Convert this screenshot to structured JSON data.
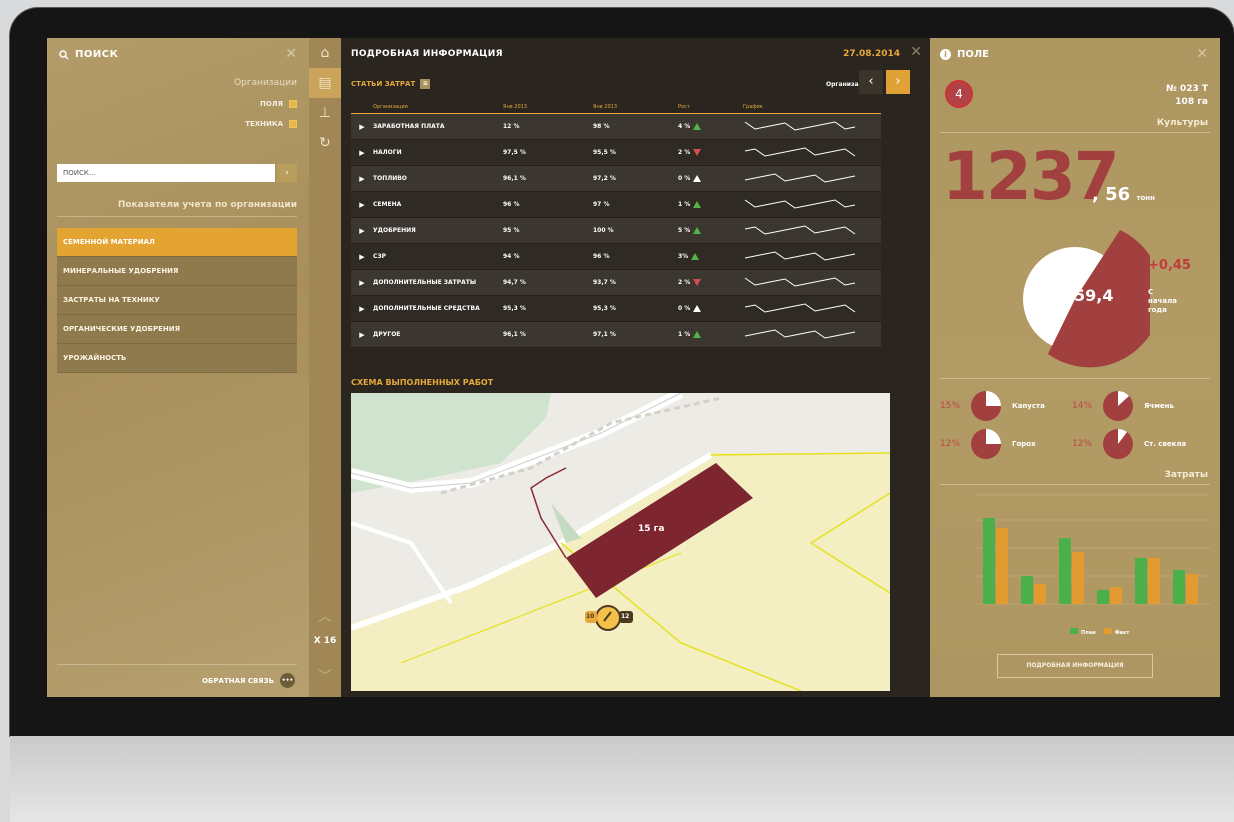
{
  "left_panel": {
    "search_title": "ПОИСК",
    "organizations_label": "Организации",
    "filters": [
      {
        "label": "ПОЛЯ",
        "checked": true
      },
      {
        "label": "ТЕХНИКА",
        "checked": true
      }
    ],
    "search_placeholder": "ПОИСК...",
    "indicators_title": "Показатели учета по организации",
    "menu": [
      {
        "label": "СЕМЕННОЙ МАТЕРИАЛ",
        "active": true
      },
      {
        "label": "МИНЕРАЛЬНЫЕ УДОБРЕНИЯ",
        "active": false
      },
      {
        "label": "ЗАСТРАТЫ НА ТЕХНИКУ",
        "active": false
      },
      {
        "label": "ОРГАНИЧЕСКИЕ УДОБРЕНИЯ",
        "active": false
      },
      {
        "label": "УРОЖАЙНОСТЬ",
        "active": false
      }
    ],
    "feedback_label": "ОБРАТНАЯ СВЯЗЬ"
  },
  "rail": {
    "icons": [
      "home-icon",
      "map-icon",
      "hierarchy-icon",
      "refresh-icon"
    ],
    "zoom": "X 16"
  },
  "center": {
    "title": "ПОДРОБНАЯ ИНФОРМАЦИЯ",
    "date": "27.08.2014",
    "section": "СТАТЬИ ЗАТРАТ",
    "org_label": "Организация",
    "columns": [
      "Организация",
      "Янв 2013",
      "Янв 2013",
      "Рост",
      "График"
    ],
    "rows": [
      {
        "name": "ЗАРАБОТНАЯ ПЛАТА",
        "v1": "12 %",
        "v2": "98 %",
        "growth": "4 %",
        "trend": "up"
      },
      {
        "name": "НАЛОГИ",
        "v1": "97,5 %",
        "v2": "95,5 %",
        "growth": "2 %",
        "trend": "down"
      },
      {
        "name": "ТОПЛИВО",
        "v1": "96,1 %",
        "v2": "97,2 %",
        "growth": "0 %",
        "trend": "neutral"
      },
      {
        "name": "СЕМЕНА",
        "v1": "96 %",
        "v2": "97 %",
        "growth": "1 %",
        "trend": "up"
      },
      {
        "name": "УДОБРЕНИЯ",
        "v1": "95 %",
        "v2": "100 %",
        "growth": "5 %",
        "trend": "up"
      },
      {
        "name": "СЗР",
        "v1": "94 %",
        "v2": "96 %",
        "growth": "3% ",
        "trend": "up"
      },
      {
        "name": "ДОПОЛНИТЕЛЬНЫЕ ЗАТРАТЫ",
        "v1": "94,7 %",
        "v2": "93,7 %",
        "growth": "2 %",
        "trend": "down"
      },
      {
        "name": "ДОПОЛНИТЕЛЬНЫЕ СРЕДСТВА",
        "v1": "95,3 %",
        "v2": "95,3 %",
        "growth": "0 %",
        "trend": "neutral"
      },
      {
        "name": "ДРУГОЕ",
        "v1": "96,1 %",
        "v2": "97,1 %",
        "growth": "1 %",
        "trend": "up"
      }
    ],
    "map_title": "СХЕМА ВЫПОЛНЕННЫХ РАБОТ",
    "map_area": "15 га",
    "map_left_count": "10",
    "map_right_count": "12"
  },
  "right_panel": {
    "title": "ПОЛЕ",
    "badge": "4",
    "field_no": "№ 023 T",
    "field_area": "108 га",
    "cultures": "Культуры",
    "big_value": "1237",
    "big_fraction": ", 56",
    "big_unit": "тонн",
    "pie_value": "59,4",
    "delta": "+0,45",
    "since": "С начала года",
    "crops": [
      {
        "pct": "15%",
        "name": "Капуста"
      },
      {
        "pct": "14%",
        "name": "Ячмень"
      },
      {
        "pct": "12%",
        "name": "Горох"
      },
      {
        "pct": "12%",
        "name": "Ст. свекла"
      }
    ],
    "expenses_title": "Затраты",
    "legend_plan": "План",
    "legend_fact": "Факт",
    "button": "ПОДРОБНАЯ ИНФОРМАЦИЯ"
  },
  "colors": {
    "accent": "#e3a432",
    "red": "#a23f3f",
    "green": "#4bb04a",
    "orange": "#e39a31"
  }
}
